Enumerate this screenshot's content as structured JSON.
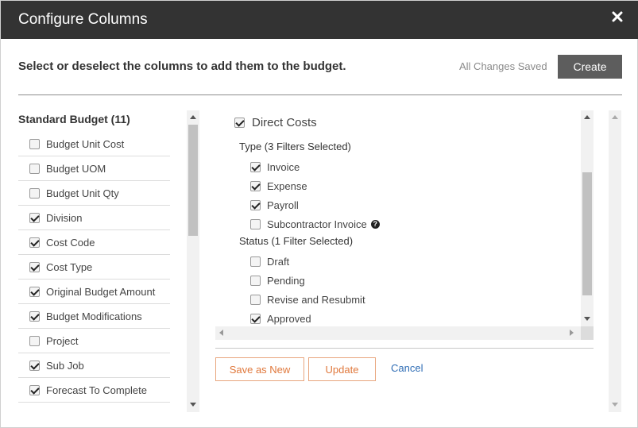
{
  "dialog": {
    "title": "Configure Columns",
    "close_icon": "close-icon",
    "instruction": "Select or deselect the columns to add them to the budget.",
    "save_status": "All Changes Saved",
    "create_label": "Create"
  },
  "left_panel": {
    "title": "Standard Budget (11)",
    "items": [
      {
        "label": "Budget Unit Cost",
        "checked": false
      },
      {
        "label": "Budget UOM",
        "checked": false
      },
      {
        "label": "Budget Unit Qty",
        "checked": false
      },
      {
        "label": "Division",
        "checked": true
      },
      {
        "label": "Cost Code",
        "checked": true
      },
      {
        "label": "Cost Type",
        "checked": true
      },
      {
        "label": "Original Budget Amount",
        "checked": true
      },
      {
        "label": "Budget Modifications",
        "checked": true
      },
      {
        "label": "Project",
        "checked": false
      },
      {
        "label": "Sub Job",
        "checked": true
      },
      {
        "label": "Forecast To Complete",
        "checked": true
      }
    ]
  },
  "right_panel": {
    "main_item": {
      "label": "Direct Costs",
      "checked": true
    },
    "type_group": {
      "title": "Type (3 Filters Selected)",
      "items": [
        {
          "label": "Invoice",
          "checked": true
        },
        {
          "label": "Expense",
          "checked": true
        },
        {
          "label": "Payroll",
          "checked": true
        },
        {
          "label": "Subcontractor Invoice",
          "checked": false,
          "help_icon": "question-circle-icon"
        }
      ]
    },
    "status_group": {
      "title": "Status (1 Filter Selected)",
      "items": [
        {
          "label": "Draft",
          "checked": false
        },
        {
          "label": "Pending",
          "checked": false
        },
        {
          "label": "Revise and Resubmit",
          "checked": false
        },
        {
          "label": "Approved",
          "checked": true
        }
      ]
    }
  },
  "actions": {
    "save_as_new_label": "Save as New",
    "update_label": "Update",
    "cancel_label": "Cancel"
  },
  "colors": {
    "header_bg": "#333333",
    "accent_orange": "#e0783c",
    "link_blue": "#2f6db5",
    "create_bg": "#5d5d5d"
  }
}
